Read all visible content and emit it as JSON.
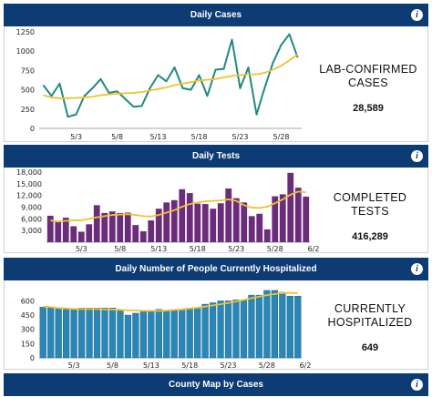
{
  "panels": [
    {
      "header": "Daily Cases",
      "stat_label": "LAB-CONFIRMED CASES",
      "stat_value": "28,589"
    },
    {
      "header": "Daily Tests",
      "stat_label": "COMPLETED TESTS",
      "stat_value": "416,289"
    },
    {
      "header": "Daily Number of People Currently Hospitalized",
      "stat_label": "CURRENTLY HOSPITALIZED",
      "stat_value": "649"
    },
    {
      "header": "County Map by Cases"
    }
  ],
  "info_glyph": "i",
  "colors": {
    "header_bg": "#0d3b73",
    "cases_line": "#1f8a80",
    "average_line": "#f2c12e",
    "tests_bar": "#6b2c7a",
    "hosp_bar": "#2a86b5"
  },
  "chart_data": [
    {
      "type": "line",
      "x": [
        "4/29",
        "4/30",
        "5/1",
        "5/2",
        "5/3",
        "5/4",
        "5/5",
        "5/6",
        "5/7",
        "5/8",
        "5/9",
        "5/10",
        "5/11",
        "5/12",
        "5/13",
        "5/14",
        "5/15",
        "5/16",
        "5/17",
        "5/18",
        "5/19",
        "5/20",
        "5/21",
        "5/22",
        "5/23",
        "5/24",
        "5/25",
        "5/26",
        "5/27",
        "5/28",
        "5/29",
        "5/30"
      ],
      "xticks": [
        "5/3",
        "5/8",
        "5/13",
        "5/18",
        "5/23",
        "5/28"
      ],
      "yticks": [
        "0",
        "250",
        "500",
        "750",
        "1000",
        "1250"
      ],
      "ylim": [
        0,
        1250
      ],
      "series": [
        {
          "values": [
            560,
            420,
            580,
            150,
            180,
            420,
            520,
            640,
            460,
            480,
            380,
            280,
            290,
            520,
            690,
            610,
            790,
            520,
            500,
            690,
            420,
            760,
            770,
            1150,
            520,
            790,
            180,
            530,
            850,
            1080,
            1220,
            920
          ]
        },
        {
          "values": [
            430,
            400,
            390,
            390,
            395,
            400,
            410,
            430,
            440,
            450,
            455,
            460,
            470,
            490,
            510,
            530,
            560,
            580,
            600,
            620,
            630,
            640,
            660,
            680,
            690,
            700,
            700,
            720,
            760,
            810,
            880,
            960
          ]
        }
      ]
    },
    {
      "type": "bar",
      "x": [
        "4/29",
        "4/30",
        "5/1",
        "5/2",
        "5/3",
        "5/4",
        "5/5",
        "5/6",
        "5/7",
        "5/8",
        "5/9",
        "5/10",
        "5/11",
        "5/12",
        "5/13",
        "5/14",
        "5/15",
        "5/16",
        "5/17",
        "5/18",
        "5/19",
        "5/20",
        "5/21",
        "5/22",
        "5/23",
        "5/24",
        "5/25",
        "5/26",
        "5/27",
        "5/28",
        "5/29",
        "5/30",
        "5/31",
        "6/1"
      ],
      "xticks": [
        "5/3",
        "5/8",
        "5/13",
        "5/18",
        "5/23",
        "5/28",
        "6/2"
      ],
      "yticks": [
        "3,000",
        "6,000",
        "9,000",
        "12,000",
        "15,000",
        "18,000"
      ],
      "ylim": [
        0,
        18000
      ],
      "series": [
        {
          "values": [
            6800,
            5500,
            6300,
            4100,
            2700,
            4600,
            9500,
            7500,
            7900,
            7500,
            7600,
            4400,
            2800,
            5600,
            8600,
            10200,
            10800,
            13600,
            12600,
            9900,
            9800,
            8600,
            10000,
            13800,
            11300,
            10200,
            6700,
            7300,
            3300,
            11800,
            12300,
            17800,
            14000,
            11700
          ]
        },
        {
          "values": [
            5600,
            5300,
            5500,
            5600,
            5600,
            6000,
            6400,
            6700,
            7000,
            7100,
            7200,
            7000,
            6700,
            6600,
            7000,
            7600,
            8200,
            9100,
            9800,
            10200,
            10500,
            10600,
            10700,
            11000,
            10600,
            9500,
            8900,
            8800,
            9100,
            10000,
            11000,
            12200,
            13000,
            12800
          ]
        }
      ]
    },
    {
      "type": "bar",
      "x": [
        "4/29",
        "4/30",
        "5/1",
        "5/2",
        "5/3",
        "5/4",
        "5/5",
        "5/6",
        "5/7",
        "5/8",
        "5/9",
        "5/10",
        "5/11",
        "5/12",
        "5/13",
        "5/14",
        "5/15",
        "5/16",
        "5/17",
        "5/18",
        "5/19",
        "5/20",
        "5/21",
        "5/22",
        "5/23",
        "5/24",
        "5/25",
        "5/26",
        "5/27",
        "5/28",
        "5/29",
        "5/30",
        "5/31",
        "6/1"
      ],
      "xticks": [
        "5/3",
        "5/8",
        "5/13",
        "5/18",
        "5/23",
        "5/28",
        "6/2"
      ],
      "yticks": [
        "0",
        "150",
        "300",
        "450",
        "600"
      ],
      "ylim": [
        0,
        700
      ],
      "series": [
        {
          "values": [
            535,
            530,
            515,
            510,
            505,
            525,
            525,
            525,
            525,
            525,
            505,
            450,
            470,
            490,
            500,
            510,
            500,
            500,
            510,
            525,
            530,
            565,
            580,
            600,
            600,
            610,
            605,
            660,
            660,
            710,
            710,
            690,
            650,
            650
          ]
        },
        {
          "values": [
            540,
            535,
            525,
            520,
            515,
            515,
            515,
            515,
            510,
            510,
            505,
            500,
            500,
            495,
            495,
            495,
            498,
            505,
            510,
            520,
            528,
            540,
            553,
            565,
            578,
            595,
            610,
            628,
            645,
            660,
            672,
            682,
            685,
            680
          ]
        }
      ]
    }
  ]
}
